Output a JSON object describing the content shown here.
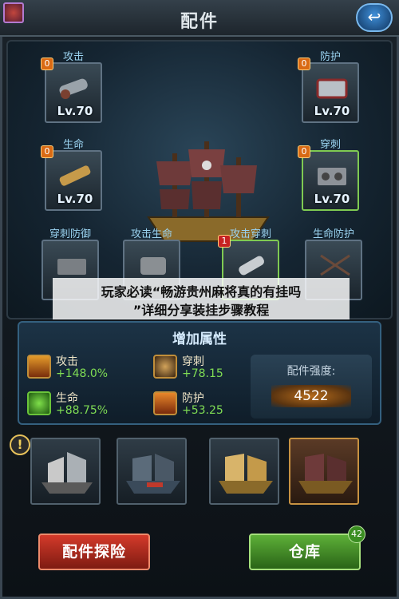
{
  "header": {
    "title": "配件"
  },
  "slots": [
    {
      "label": "攻击",
      "level": "Lv.70",
      "badge": "0"
    },
    {
      "label": "防护",
      "level": "Lv.70",
      "badge": "0"
    },
    {
      "label": "生命",
      "level": "Lv.70",
      "badge": "0"
    },
    {
      "label": "穿刺",
      "level": "Lv.70",
      "badge": "0"
    },
    {
      "label": "穿刺防御"
    },
    {
      "label": "攻击生命"
    },
    {
      "label": "攻击穿刺",
      "badge": "1"
    },
    {
      "label": "生命防护"
    }
  ],
  "banner": {
    "line1": "玩家必读“畅游贵州麻将真的有挂吗",
    "line2": "”详细分享装挂步骤教程"
  },
  "attributes": {
    "title": "增加属性",
    "items": [
      {
        "name": "攻击",
        "value": "+148.0%",
        "icon": "attack-icon"
      },
      {
        "name": "穿刺",
        "value": "+78.15",
        "icon": "pierce-icon"
      },
      {
        "name": "生命",
        "value": "+88.75%",
        "icon": "life-icon"
      },
      {
        "name": "防护",
        "value": "+53.25",
        "icon": "defense-icon"
      }
    ],
    "strength_label": "配件强度:",
    "strength_value": "4522"
  },
  "ships": [
    {
      "name": "ship-1"
    },
    {
      "name": "ship-2"
    },
    {
      "name": "ship-3"
    },
    {
      "name": "ship-4",
      "selected": true
    }
  ],
  "buttons": {
    "explore": "配件探险",
    "warehouse": "仓库",
    "warehouse_count": "42"
  },
  "colors": {
    "accent_green": "#7fdc54",
    "label_blue": "#9ad2ef",
    "button_red": "#d43a2a",
    "button_green": "#5db038"
  }
}
